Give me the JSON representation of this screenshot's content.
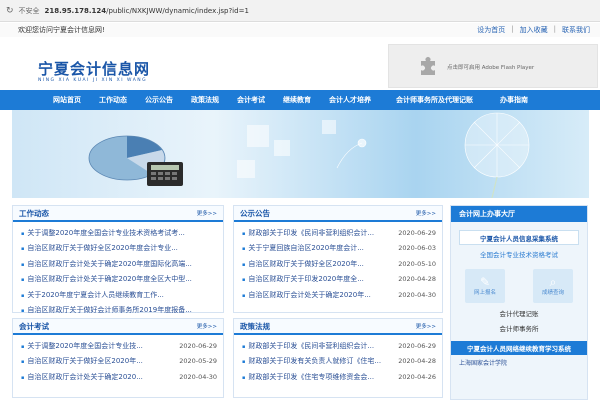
{
  "browser": {
    "security": "不安全",
    "url_host": "218.95.178.124",
    "url_path": "/public/NXKJWW/dynamic/index.jsp?id=1"
  },
  "topstrip": {
    "welcome": "欢迎您访问宁夏会计信息网!",
    "links": [
      "设为首页",
      "加入收藏",
      "联系我们"
    ]
  },
  "header": {
    "logo_cn": "宁夏会计信息网",
    "logo_pinyin": "NING XIA KUAI JI XIN XI WANG",
    "flash_text": "点击即可启用 Adobe Flash Player"
  },
  "nav": [
    "网站首页",
    "工作动态",
    "公示公告",
    "政策法规",
    "会计考试",
    "继续教育",
    "会计人才培养",
    "会计师事务所及代理记账",
    "办事指南"
  ],
  "colors": {
    "brand": "#1d7bd6",
    "title": "#1a56a8"
  },
  "panels": {
    "work": {
      "title": "工作动态",
      "more": "更多>>",
      "items": [
        {
          "t": "关于调整2020年度全国会计专业技术资格考试考..."
        },
        {
          "t": "自治区财政厅关于做好全区2020年度会计专业..."
        },
        {
          "t": "自治区财政厅会计处关于确定2020年度国际化高端..."
        },
        {
          "t": "自治区财政厅会计处关于确定2020年度全区大中型..."
        },
        {
          "t": "关于2020年度宁夏会计人员继续教育工作..."
        },
        {
          "t": "自治区财政厅关于做好会计师事务所2019年度报备..."
        }
      ]
    },
    "notice": {
      "title": "公示公告",
      "more": "更多>>",
      "items": [
        {
          "t": "财政部关于印发《民间非营利组织会计...",
          "d": "2020-06-29"
        },
        {
          "t": "关于宁夏回族自治区2020年度会计...",
          "d": "2020-06-03"
        },
        {
          "t": "自治区财政厅关于做好全区2020年...",
          "d": "2020-05-10"
        },
        {
          "t": "自治区财政厅关于印发2020年度全...",
          "d": "2020-04-28"
        },
        {
          "t": "自治区财政厅会计处关于确定2020年...",
          "d": "2020-04-30"
        }
      ]
    },
    "exam": {
      "title": "会计考试",
      "more": "更多>>",
      "items": [
        {
          "t": "关于调整2020年度全国会计专业技...",
          "d": "2020-06-29"
        },
        {
          "t": "自治区财政厅关于做好全区2020年...",
          "d": "2020-05-29"
        },
        {
          "t": "自治区财政厅会计处关于确定2020...",
          "d": "2020-04-30"
        }
      ]
    },
    "policy": {
      "title": "政策法规",
      "more": "更多>>",
      "items": [
        {
          "t": "财政部关于印发《民间非营利组织会计...",
          "d": "2020-06-29"
        },
        {
          "t": "财政部关于印发有关负责人就修订《住宅...",
          "d": "2020-04-28"
        },
        {
          "t": "财政部关于印发《住宅专项维修资金会...",
          "d": "2020-04-26"
        }
      ]
    }
  },
  "side": {
    "title": "会计网上办事大厅",
    "btn": "宁夏会计人员信息采集系统",
    "sub": "全国会计专业技术资格考试",
    "icons": [
      {
        "name": "网上报名",
        "glyph": "✎"
      },
      {
        "name": "成绩查询",
        "glyph": "⌕"
      }
    ],
    "links": [
      "会计代理记账",
      "会计师事务所"
    ],
    "edu_title": "宁夏会计人员网络继续教育学习系统",
    "edu_list": [
      "上海国家会计学院"
    ]
  }
}
